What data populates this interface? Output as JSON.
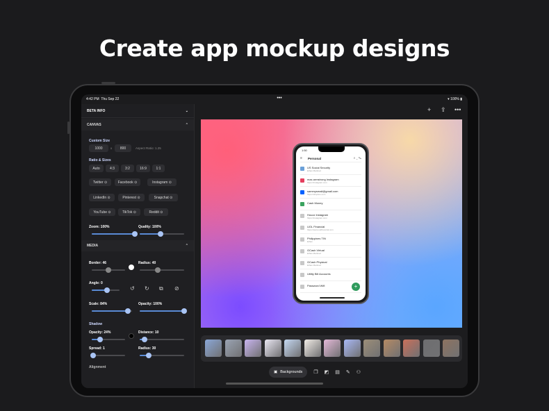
{
  "headline": "Create app mockup designs",
  "status": {
    "time": "4:42 PM",
    "date": "Thu Sep 22",
    "battery": "100%"
  },
  "sidebar": {
    "title": "BETA INFO",
    "canvas": {
      "header": "CANVAS",
      "custom_size_label": "Custom Size",
      "width": "1000",
      "times": "x",
      "height": "800",
      "aspect": "Aspect Ratio: 1.25",
      "ratio_label": "Ratio & Sizes",
      "ratios": [
        "Auto",
        "4:3",
        "3:2",
        "16:9",
        "1:1"
      ],
      "socials_row1": [
        "Twitter",
        "Facebook",
        "Instagram"
      ],
      "socials_row2": [
        "LinkedIn",
        "Pinterest",
        "Snapchat"
      ],
      "socials_row3": [
        "YouTube",
        "TikTok",
        "Reddit"
      ],
      "zoom": "Zoom: 100%",
      "quality": "Quality: 100%",
      "zoom_level": 100,
      "quality_level": 100
    },
    "media": {
      "header": "MEDIA",
      "border": "Border: 46",
      "radius": "Radius: 40",
      "angle": "Angle: 0",
      "scale": "Scale: 84%",
      "opacity": "Opacity: 100%"
    },
    "shadow": {
      "header": "Shadow",
      "opacity": "Opacity: 24%",
      "distance": "Distance: 10",
      "spread": "Spread: 1",
      "radius": "Radius: 30"
    },
    "alignment": "Alignment"
  },
  "phone": {
    "time": "1:50",
    "folder": "Personal",
    "items": [
      {
        "title": "US Social Security",
        "sub": "Ethan Martinez",
        "color": "#6aa0d8"
      },
      {
        "title": "max.armstrong Instagram",
        "sub": "https://instagram.com",
        "color": "#e4405f"
      },
      {
        "title": "sammysmail@gmail.com",
        "sub": "https://dropbox.com",
        "color": "#0061ff"
      },
      {
        "title": "Cash Money",
        "sub": "",
        "color": "#3aa35f"
      },
      {
        "title": "Houzz Instagram",
        "sub": "https://instagram.com",
        "color": "#c8c8c8"
      },
      {
        "title": "UOL Financial",
        "sub": "https://www.uolfinancial.com",
        "color": "#c8c8c8"
      },
      {
        "title": "Philippines TIN",
        "sub": "Ethan",
        "color": "#c8c8c8"
      },
      {
        "title": "GCash Virtual",
        "sub": "Ethan Martinez",
        "color": "#c8c8c8"
      },
      {
        "title": "GCash Physical",
        "sub": "Ethan Martinez",
        "color": "#c8c8c8"
      },
      {
        "title": "Utility Bill Accounts",
        "sub": "",
        "color": "#c8c8c8"
      },
      {
        "title": "Password Wifi",
        "sub": "",
        "color": "#c8c8c8"
      }
    ]
  },
  "bottom": {
    "backgrounds": "Backgrounds"
  },
  "thumb_colors": [
    "#8aa7d8",
    "#9aa3b3",
    "#c9b4f0",
    "#e9e6f2",
    "#c4d8f2",
    "#f1ece6",
    "#e4b8d8",
    "#a8b8f6",
    "#9c8e78",
    "#b58a64",
    "#c9705b",
    "#6e6e70",
    "#8d7360"
  ]
}
